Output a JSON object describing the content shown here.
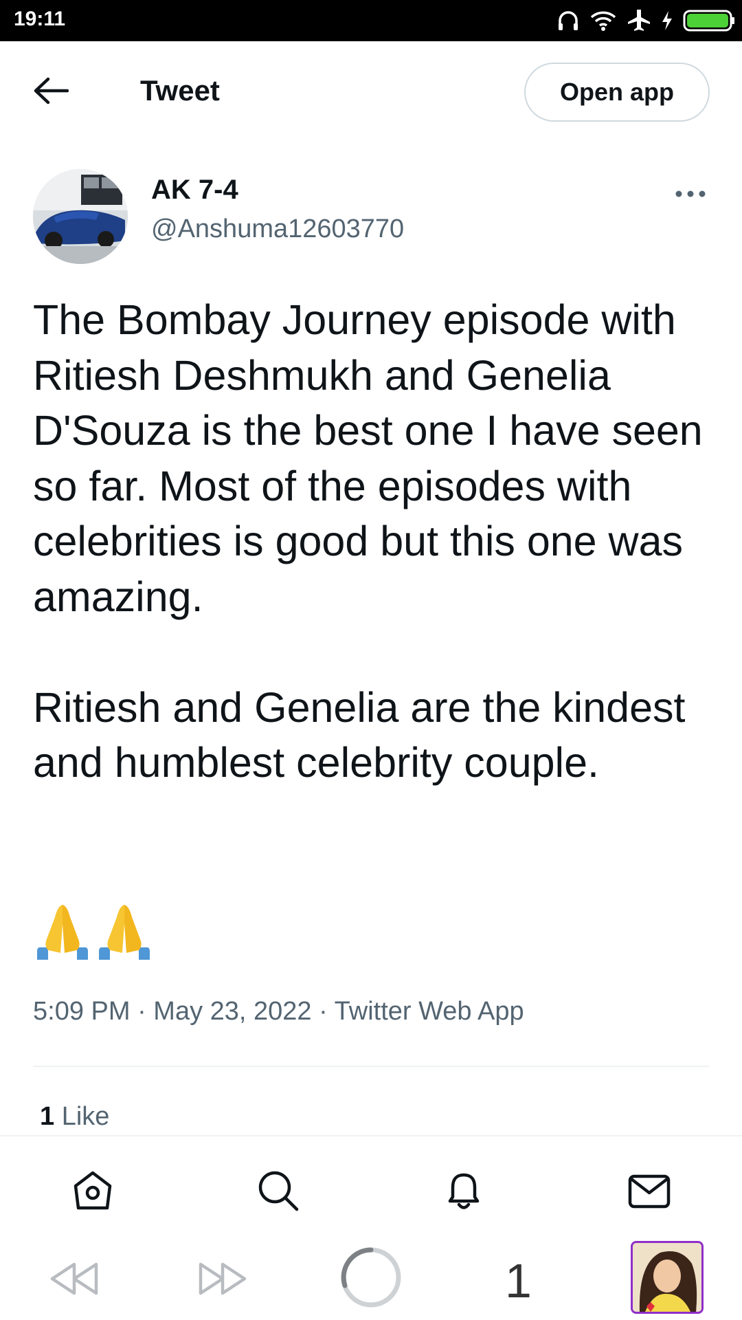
{
  "status_bar": {
    "time": "19:11"
  },
  "header": {
    "title": "Tweet",
    "open_app_label": "Open app"
  },
  "tweet": {
    "display_name": "AK 7-4",
    "handle": "@Anshuma12603770",
    "text": "The Bombay Journey episode with Ritiesh Deshmukh and Genelia D'Souza is the best one I have seen so far. Most of the episodes with celebrities is good but this one was amazing.\n\nRitiesh and Genelia are the kindest and humblest celebrity couple.",
    "emoji": "🙏🙏",
    "meta": "5:09 PM · May 23, 2022 · Twitter Web App",
    "like_count": "1",
    "like_label": "Like"
  },
  "browser": {
    "tab_count": "1"
  },
  "colors": {
    "text": "#0f1419",
    "secondary": "#536471",
    "border": "#cfd9de",
    "battery": "#4cd137",
    "tab_avatar_border": "#8e2ec9"
  }
}
